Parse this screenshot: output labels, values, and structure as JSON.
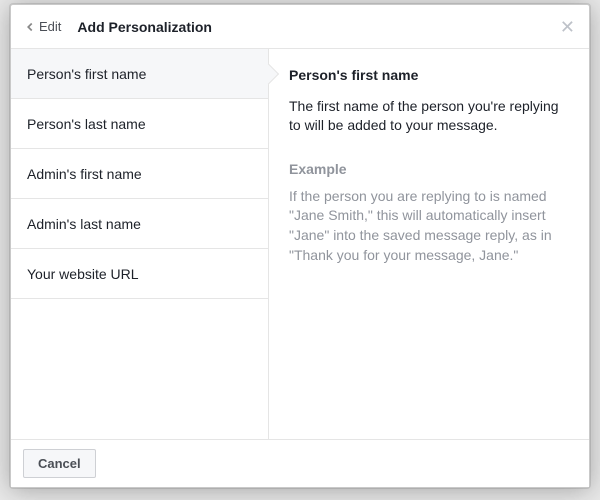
{
  "header": {
    "back_label": "Edit",
    "title": "Add Personalization"
  },
  "sidebar": {
    "items": [
      {
        "label": "Person's first name",
        "selected": true
      },
      {
        "label": "Person's last name",
        "selected": false
      },
      {
        "label": "Admin's first name",
        "selected": false
      },
      {
        "label": "Admin's last name",
        "selected": false
      },
      {
        "label": "Your website URL",
        "selected": false
      }
    ]
  },
  "detail": {
    "title": "Person's first name",
    "description": "The first name of the person you're replying to will be added to your message.",
    "example_label": "Example",
    "example_text": "If the person you are replying to is named \"Jane Smith,\" this will automatically insert \"Jane\" into the saved message reply, as in \"Thank you for your message, Jane.\""
  },
  "footer": {
    "cancel_label": "Cancel"
  }
}
